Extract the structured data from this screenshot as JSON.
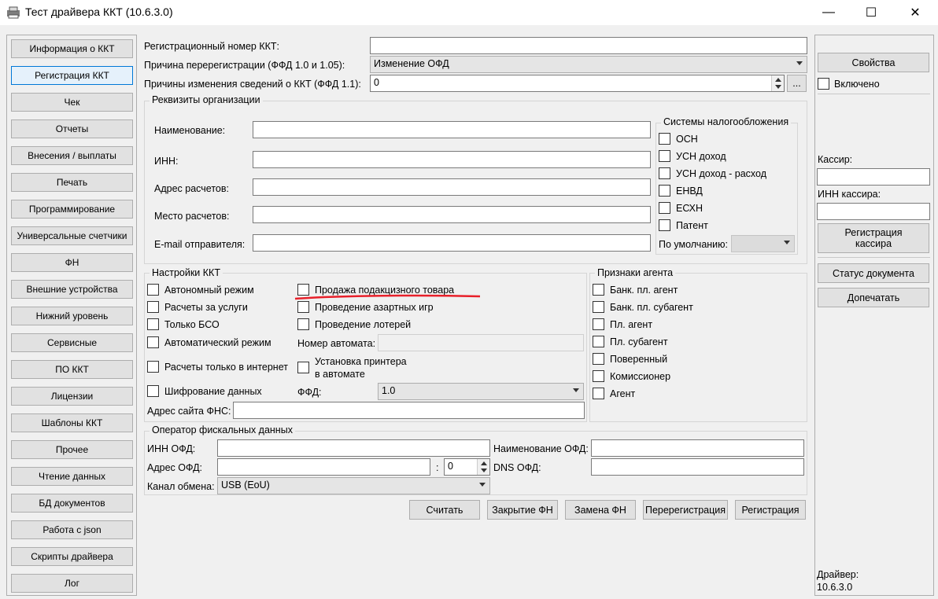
{
  "window": {
    "title": "Тест драйвера ККТ (10.6.3.0)",
    "minimize_glyph": "—",
    "maximize_glyph": "☐",
    "close_glyph": "✕"
  },
  "nav": {
    "items": [
      "Информация о ККТ",
      "Регистрация ККТ",
      "Чек",
      "Отчеты",
      "Внесения / выплаты",
      "Печать",
      "Программирование",
      "Универсальные счетчики",
      "ФН",
      "Внешние устройства",
      "Нижний уровень",
      "Сервисные",
      "ПО ККТ",
      "Лицензии",
      "Шаблоны ККТ",
      "Прочее",
      "Чтение данных",
      "БД документов",
      "Работа с json",
      "Скрипты драйвера",
      "Лог"
    ],
    "active_index": 1
  },
  "top": {
    "reg_number_label": "Регистрационный номер ККТ:",
    "reg_number_value": "",
    "rereg_reason_label": "Причина перерегистрации (ФФД 1.0 и 1.05):",
    "rereg_reason_value": "Изменение ОФД",
    "change_reasons_label": "Причины изменения сведений о ККТ (ФФД 1.1):",
    "change_reasons_value": "0",
    "more_button": "..."
  },
  "org": {
    "title": "Реквизиты организации",
    "name_label": "Наименование:",
    "inn_label": "ИНН:",
    "address_label": "Адрес расчетов:",
    "place_label": "Место расчетов:",
    "email_label": "E-mail отправителя:",
    "name_value": "",
    "inn_value": "",
    "address_value": "",
    "place_value": "",
    "email_value": ""
  },
  "tax": {
    "title": "Системы налогообложения",
    "items": [
      "ОСН",
      "УСН доход",
      "УСН доход - расход",
      "ЕНВД",
      "ЕСХН",
      "Патент"
    ],
    "default_label": "По умолчанию:",
    "default_value": ""
  },
  "settings": {
    "title": "Настройки ККТ",
    "left": [
      "Автономный режим",
      "Расчеты за услуги",
      "Только БСО",
      "Автоматический режим",
      "Расчеты только в интернет",
      "Шифрование данных"
    ],
    "right": [
      "Продажа подакцизного товара",
      "Проведение азартных игр",
      "Проведение лотерей"
    ],
    "machine_number_label": "Номер автомата:",
    "machine_number_value": "",
    "printer_install_line1": "Установка принтера",
    "printer_install_line2": "в автомате",
    "ffd_label": "ФФД:",
    "ffd_value": "1.0",
    "fns_site_label": "Адрес сайта ФНС:",
    "fns_site_value": ""
  },
  "agent": {
    "title": "Признаки агента",
    "items": [
      "Банк. пл. агент",
      "Банк. пл. субагент",
      "Пл. агент",
      "Пл. субагент",
      "Поверенный",
      "Комиссионер",
      "Агент"
    ]
  },
  "ofd": {
    "title": "Оператор фискальных данных",
    "inn_label": "ИНН ОФД:",
    "inn_value": "",
    "name_label": "Наименование ОФД:",
    "name_value": "",
    "address_label": "Адрес ОФД:",
    "address_value": "",
    "port_sep": ":",
    "port_value": "0",
    "dns_label": "DNS ОФД:",
    "dns_value": "",
    "channel_label": "Канал обмена:",
    "channel_value": "USB (EoU)"
  },
  "actions": [
    "Считать",
    "Закрытие ФН",
    "Замена ФН",
    "Перерегистрация",
    "Регистрация"
  ],
  "right_panel": {
    "properties_button": "Свойства",
    "enabled_label": "Включено",
    "cashier_label": "Кассир:",
    "cashier_value": "",
    "cashier_inn_label": "ИНН кассира:",
    "cashier_inn_value": "",
    "cashier_reg_button_line1": "Регистрация",
    "cashier_reg_button_line2": "кассира",
    "doc_status_button": "Статус документа",
    "reprint_button": "Допечатать",
    "driver_label": "Драйвер:",
    "driver_version": "10.6.3.0"
  },
  "colors": {
    "accent": "#0078d7",
    "annotation": "#e8202a"
  }
}
